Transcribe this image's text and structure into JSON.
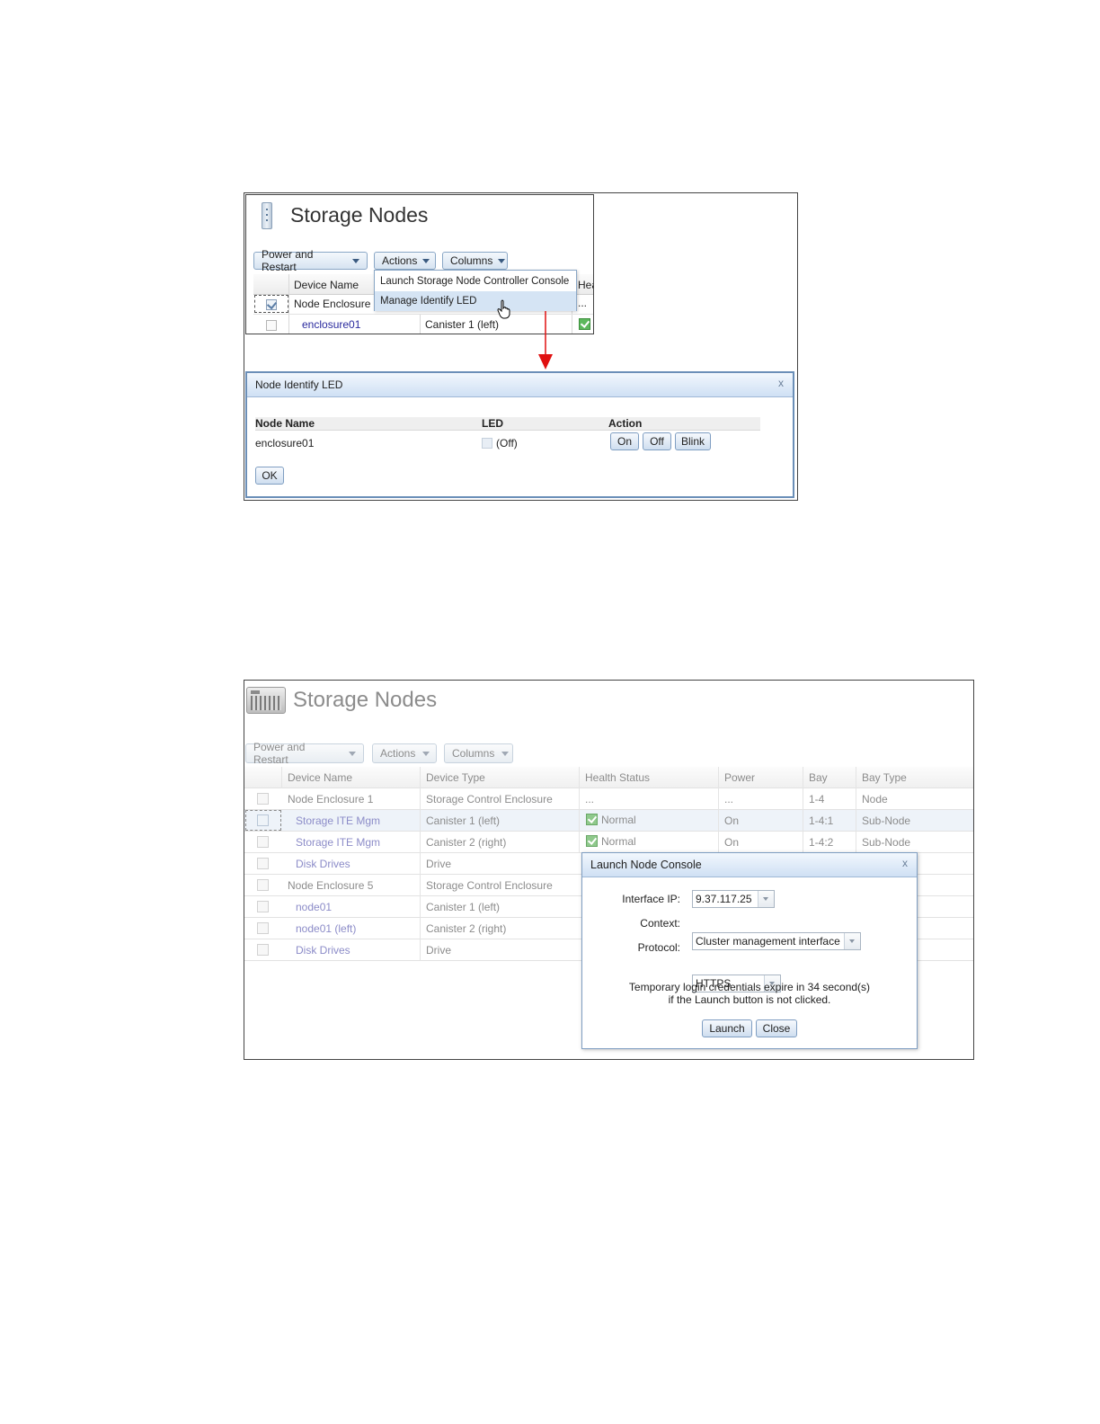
{
  "figure1": {
    "panel": {
      "title": "Storage Nodes",
      "toolbar": {
        "power_restart": "Power and Restart",
        "actions": "Actions",
        "columns": "Columns"
      },
      "columns": [
        "Device Name",
        "Hea"
      ],
      "rows": [
        {
          "name": "Node Enclosure",
          "type": "",
          "health": "..."
        },
        {
          "name": "enclosure01",
          "type": "Canister 1 (left)",
          "health": "ok"
        }
      ]
    },
    "actions_menu": {
      "items": [
        "Launch Storage Node Controller Console",
        "Manage Identify LED"
      ],
      "highlighted_index": 1
    },
    "dialog": {
      "title": "Node Identify LED",
      "close": "x",
      "headers": {
        "node_name": "Node Name",
        "led": "LED",
        "action": "Action"
      },
      "row": {
        "node_name": "enclosure01",
        "led_state": "(Off)"
      },
      "buttons": {
        "on": "On",
        "off": "Off",
        "blink": "Blink",
        "ok": "OK"
      }
    },
    "colors": {
      "arrow": "#e01010",
      "dialog_border": "#6b8fb8"
    }
  },
  "figure2": {
    "panel": {
      "title": "Storage Nodes",
      "toolbar": {
        "power_restart": "Power and Restart",
        "actions": "Actions",
        "columns": "Columns"
      },
      "columns": [
        "Device Name",
        "Device Type",
        "Health Status",
        "Power",
        "Bay",
        "Bay Type"
      ],
      "rows": [
        {
          "name": "Node Enclosure 1",
          "link": false,
          "type": "Storage Control Enclosure",
          "health": "...",
          "power": "...",
          "bay": "1-4",
          "bay_type": "Node"
        },
        {
          "name": "Storage ITE Mgm",
          "link": true,
          "type": "Canister 1 (left)",
          "health": "Normal",
          "power": "On",
          "bay": "1-4:1",
          "bay_type": "Sub-Node",
          "selected": true
        },
        {
          "name": "Storage ITE Mgm",
          "link": true,
          "type": "Canister 2 (right)",
          "health": "Normal",
          "power": "On",
          "bay": "1-4:2",
          "bay_type": "Sub-Node"
        },
        {
          "name": "Disk Drives",
          "link": true,
          "type": "Drive"
        },
        {
          "name": "Node Enclosure 5",
          "link": false,
          "type": "Storage Control Enclosure"
        },
        {
          "name": "node01",
          "link": true,
          "type": "Canister 1 (left)"
        },
        {
          "name": "node01 (left)",
          "link": true,
          "type": "Canister 2 (right)"
        },
        {
          "name": "Disk Drives",
          "link": true,
          "type": "Drive"
        }
      ]
    },
    "dialog": {
      "title": "Launch Node Console",
      "close": "x",
      "interface_ip_label": "Interface IP:",
      "interface_ip_value": "9.37.117.25",
      "context_label": "Context:",
      "context_value": "Cluster management interface",
      "protocol_label": "Protocol:",
      "protocol_value": "HTTPS",
      "message_line1": "Temporary login credentials expire in 34 second(s)",
      "message_line2": "if the Launch button is not clicked.",
      "launch": "Launch",
      "close_button": "Close"
    }
  }
}
